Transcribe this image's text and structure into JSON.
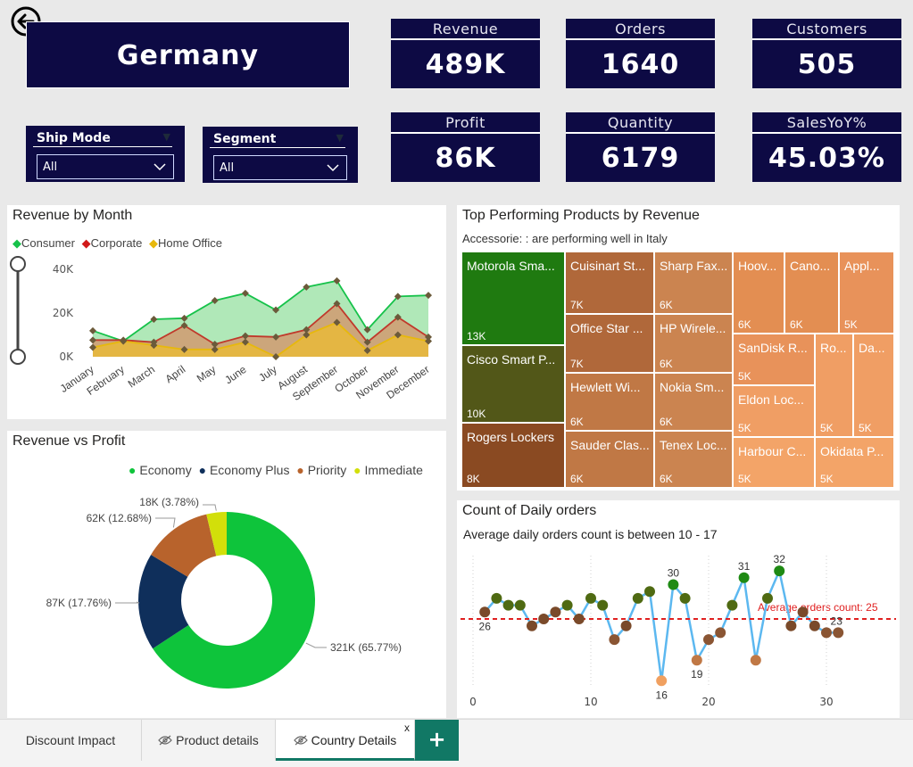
{
  "country": "Germany",
  "kpis": {
    "revenue": {
      "label": "Revenue",
      "value": "489K"
    },
    "orders": {
      "label": "Orders",
      "value": "1640"
    },
    "customers": {
      "label": "Customers",
      "value": "505"
    },
    "profit": {
      "label": "Profit",
      "value": "86K"
    },
    "quantity": {
      "label": "Quantity",
      "value": "6179"
    },
    "sales_yoy": {
      "label": "SalesYoY%",
      "value": "45.03%"
    }
  },
  "slicers": {
    "ship_mode": {
      "label": "Ship Mode",
      "value": "All"
    },
    "segment": {
      "label": "Segment",
      "value": "All"
    }
  },
  "revenue_by_month": {
    "title": "Revenue by Month",
    "legend": [
      "Consumer",
      "Corporate",
      "Home Office"
    ],
    "colors": [
      "#16c24a",
      "#d11919",
      "#e7b80c"
    ],
    "ytick_labels": [
      "40K",
      "20K",
      "0K"
    ],
    "chart_data": {
      "type": "area",
      "categories": [
        "January",
        "February",
        "March",
        "April",
        "May",
        "June",
        "July",
        "August",
        "September",
        "October",
        "November",
        "December"
      ],
      "ylim": [
        0,
        45000
      ],
      "series": [
        {
          "name": "Consumer",
          "values": [
            12500,
            7500,
            18000,
            18500,
            27000,
            30500,
            22500,
            33500,
            36500,
            13000,
            29000,
            29500
          ]
        },
        {
          "name": "Corporate",
          "values": [
            8000,
            8000,
            7000,
            15000,
            6000,
            10000,
            9500,
            13000,
            25500,
            7000,
            19000,
            9500
          ]
        },
        {
          "name": "Home Office",
          "values": [
            4500,
            7500,
            5500,
            3500,
            3500,
            7000,
            0,
            10500,
            16500,
            3000,
            10500,
            7500
          ]
        }
      ]
    }
  },
  "top_products": {
    "title": "Top Performing Products by Revenue",
    "subtitle": "Accessorie: : are performing well in Italy",
    "items": [
      {
        "name": "Motorola Sma...",
        "value": "13K",
        "color": "#1f7a10"
      },
      {
        "name": "Cisco Smart P...",
        "value": "10K",
        "color": "#525718"
      },
      {
        "name": "Rogers Lockers",
        "value": "8K",
        "color": "#8a4a22"
      },
      {
        "name": "Cuisinart St...",
        "value": "7K",
        "color": "#b0683a"
      },
      {
        "name": "Office Star ...",
        "value": "7K",
        "color": "#b0683a"
      },
      {
        "name": "Hewlett Wi...",
        "value": "6K",
        "color": "#c07845"
      },
      {
        "name": "Sauder Clas...",
        "value": "6K",
        "color": "#c07845"
      },
      {
        "name": "Sharp Fax...",
        "value": "6K",
        "color": "#cb8450"
      },
      {
        "name": "HP Wirele...",
        "value": "6K",
        "color": "#cb8450"
      },
      {
        "name": "Nokia Sm...",
        "value": "6K",
        "color": "#cb8450"
      },
      {
        "name": "Tenex Loc...",
        "value": "6K",
        "color": "#cb8450"
      },
      {
        "name": "Hoov...",
        "value": "6K",
        "color": "#e38e52"
      },
      {
        "name": "Cano...",
        "value": "6K",
        "color": "#e38e52"
      },
      {
        "name": "Appl...",
        "value": "5K",
        "color": "#e8925a"
      },
      {
        "name": "SanDisk R...",
        "value": "5K",
        "color": "#e8925a"
      },
      {
        "name": "Ro...",
        "value": "5K",
        "color": "#f09e64"
      },
      {
        "name": "Da...",
        "value": "5K",
        "color": "#f09e64"
      },
      {
        "name": "Eldon Loc...",
        "value": "5K",
        "color": "#f09e64"
      },
      {
        "name": "Harbour C...",
        "value": "5K",
        "color": "#f3a468"
      },
      {
        "name": "Okidata P...",
        "value": "5K",
        "color": "#f3a468"
      }
    ]
  },
  "revenue_vs_profit": {
    "title": "Revenue vs Profit",
    "chart_data": {
      "type": "pie",
      "series": [
        {
          "name": "Economy",
          "value": 321,
          "label": "321K (65.77%)",
          "color": "#0ec43b"
        },
        {
          "name": "Economy Plus",
          "value": 87,
          "label": "87K (17.76%)",
          "color": "#0f2f5b"
        },
        {
          "name": "Priority",
          "value": 62,
          "label": "62K (12.68%)",
          "color": "#b8632c"
        },
        {
          "name": "Immediate",
          "value": 18,
          "label": "18K (3.78%)",
          "color": "#d2df0a"
        }
      ]
    }
  },
  "daily_orders": {
    "title": "Count of Daily orders",
    "subtitle": "Average daily orders count is between 10 - 17",
    "avg_label": "Average orders count: 25",
    "xtick_labels": [
      "0",
      "10",
      "20",
      "30"
    ],
    "chart_data": {
      "type": "line",
      "xlim": [
        0,
        31
      ],
      "average": 25,
      "x": [
        1,
        2,
        3,
        4,
        5,
        6,
        7,
        8,
        9,
        10,
        11,
        12,
        13,
        14,
        15,
        16,
        17,
        18,
        19,
        20,
        21,
        22,
        23,
        24,
        25,
        26,
        27,
        28,
        29,
        30,
        31
      ],
      "values": [
        26,
        28,
        27,
        27,
        24,
        25,
        26,
        27,
        25,
        28,
        27,
        22,
        24,
        28,
        29,
        16,
        30,
        28,
        19,
        22,
        23,
        27,
        31,
        19,
        28,
        32,
        24,
        26,
        24,
        23,
        23
      ],
      "point_labels": {
        "1": "26",
        "16": "16",
        "17": "30",
        "19": "19",
        "23": "31",
        "26": "32",
        "31": "23"
      }
    }
  },
  "tabs": [
    {
      "label": "Discount Impact"
    },
    {
      "label": "Product details"
    },
    {
      "label": "Country Details",
      "close": "x"
    }
  ],
  "add_tab": "+"
}
